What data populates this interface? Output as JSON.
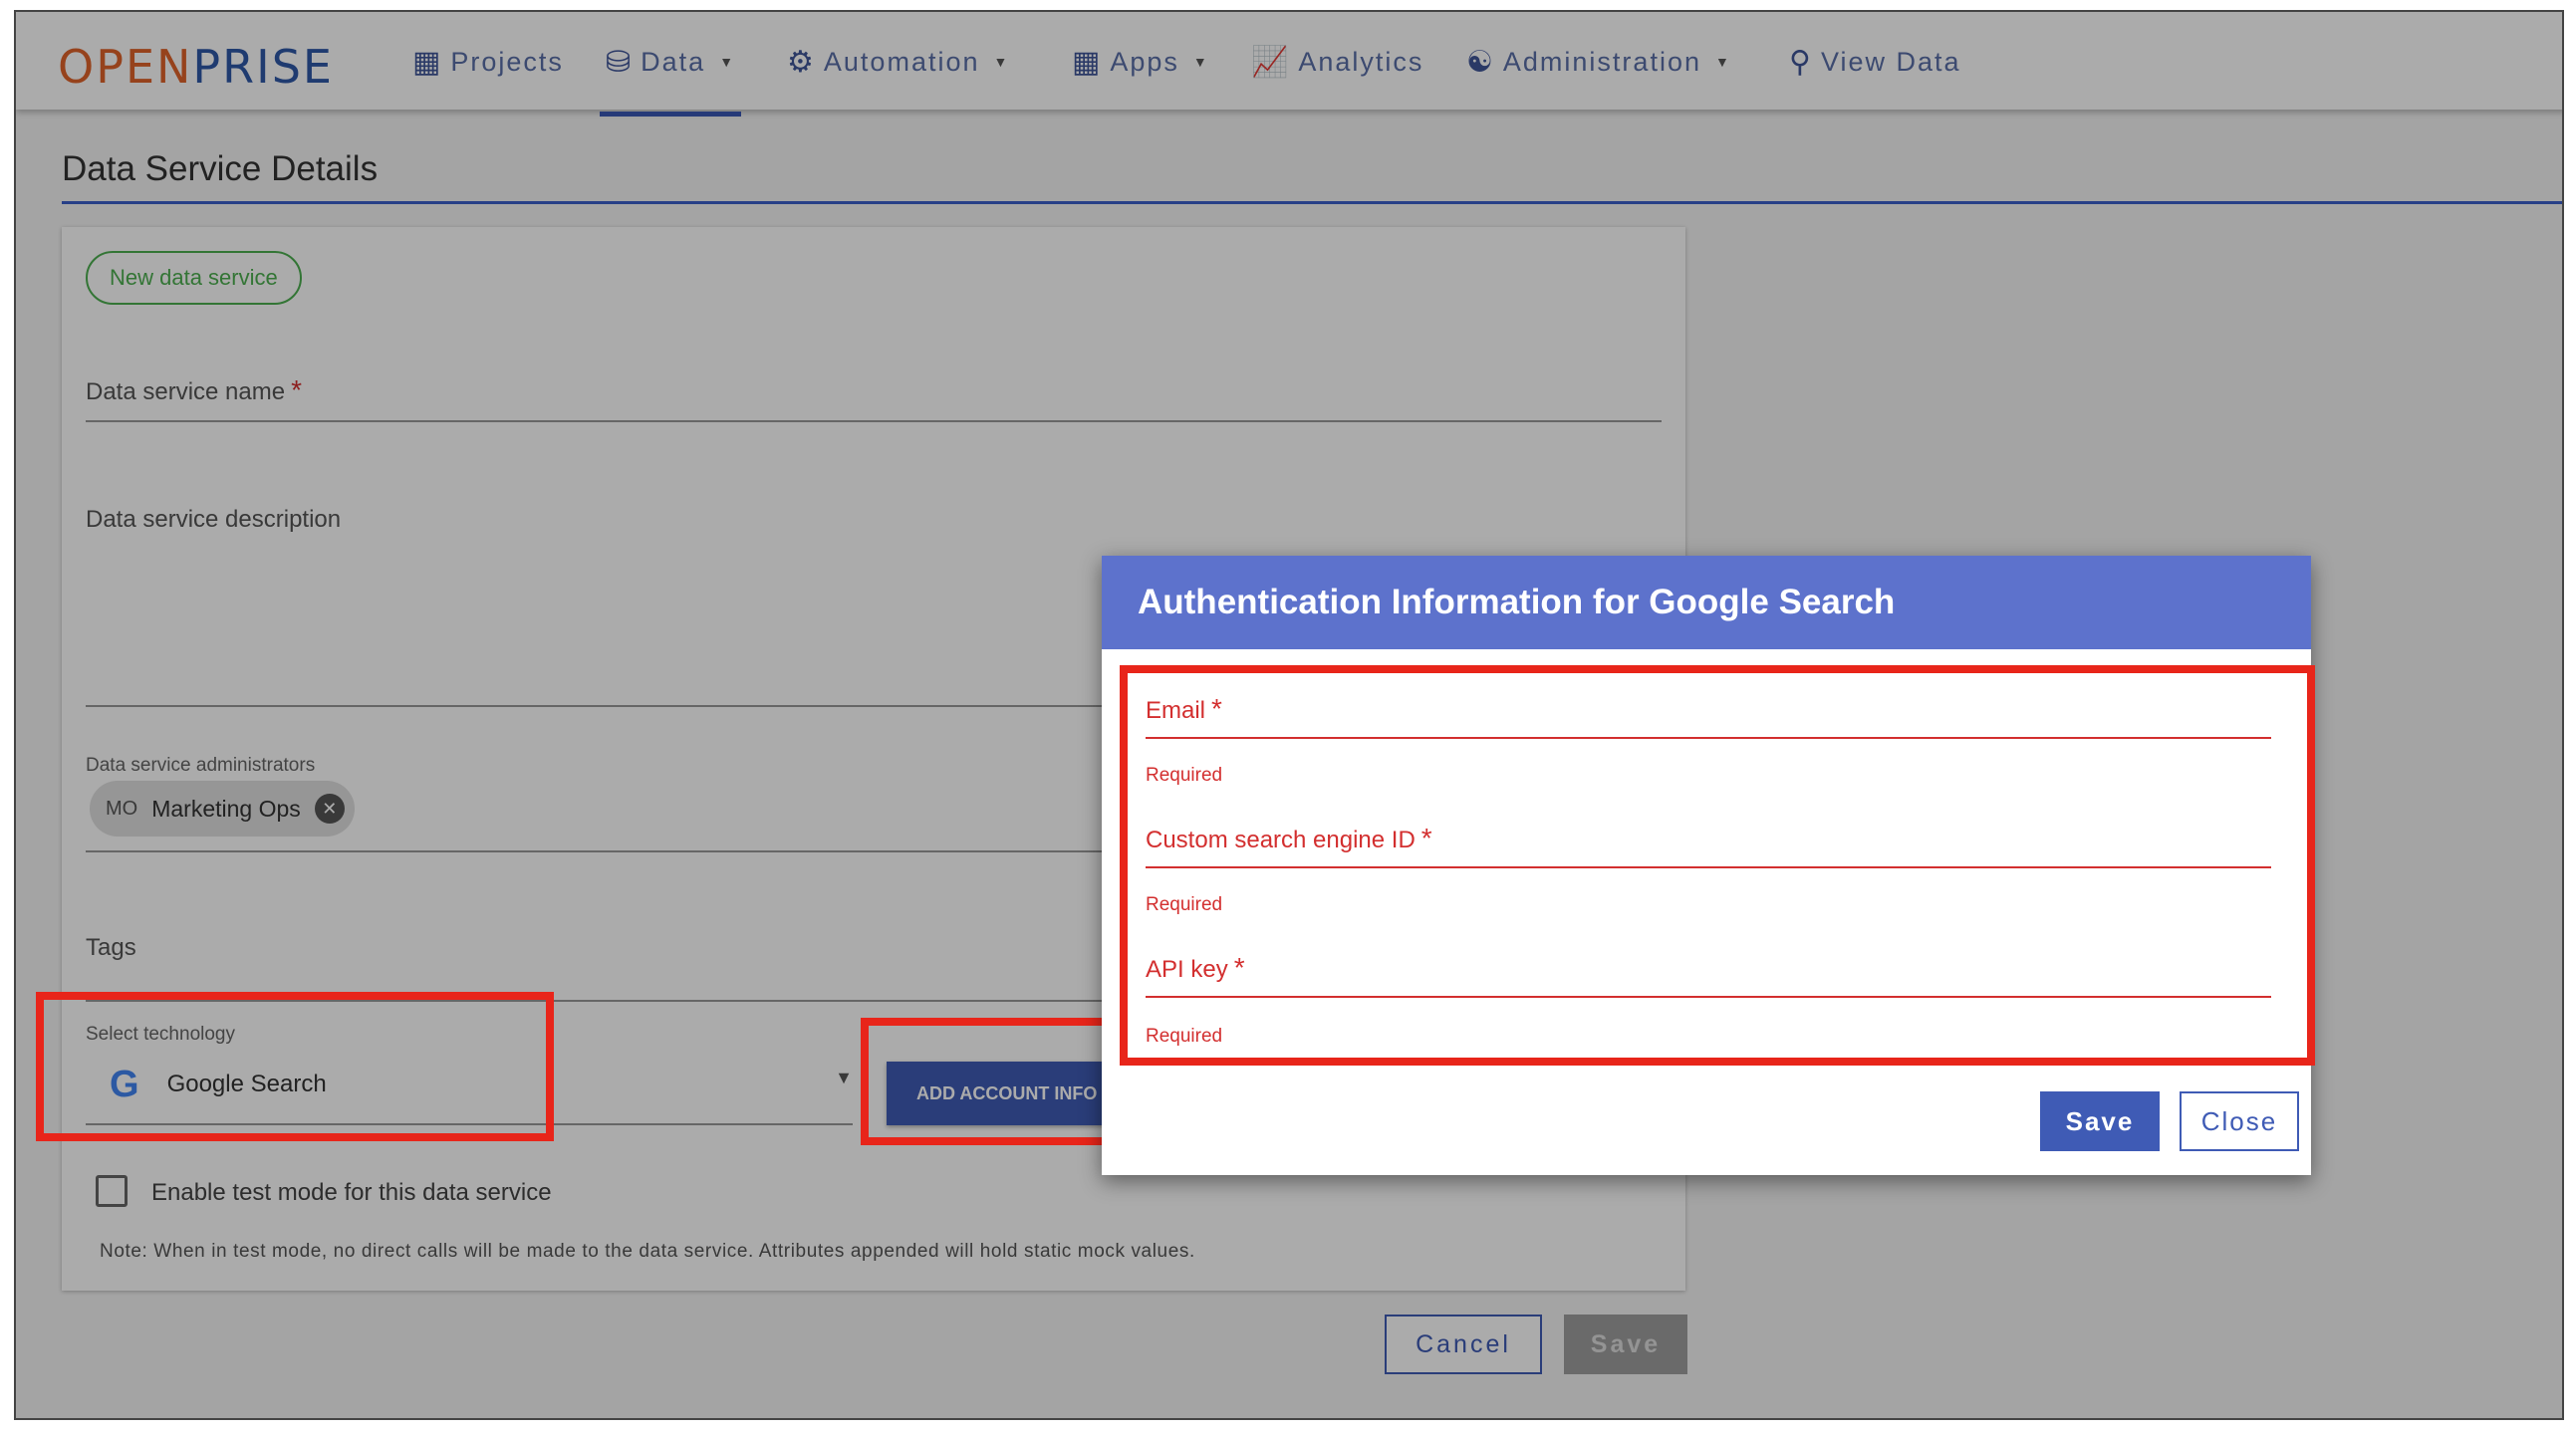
{
  "nav": {
    "logo_part1": "OPEN",
    "logo_part2": "PRISE",
    "items": [
      {
        "label": "Projects",
        "icon": "grid-icon"
      },
      {
        "label": "Data",
        "icon": "database-icon"
      },
      {
        "label": "Automation",
        "icon": "gears-icon"
      },
      {
        "label": "Apps",
        "icon": "grid-icon"
      },
      {
        "label": "Analytics",
        "icon": "chart-icon"
      },
      {
        "label": "Administration",
        "icon": "user-gear-icon"
      },
      {
        "label": "View Data",
        "icon": "search-icon"
      }
    ]
  },
  "page": {
    "title": "Data Service Details"
  },
  "form": {
    "new_chip": "New data service",
    "name_label": "Data service name",
    "description_label": "Data service description",
    "admins_label": "Data service administrators",
    "admin_chip": {
      "initials": "MO",
      "name": "Marketing Ops"
    },
    "tags_label": "Tags",
    "technology_label": "Select technology",
    "technology_value": "Google Search",
    "add_account_label": "ADD ACCOUNT INFO",
    "test_mode_label": "Enable test mode for this data service",
    "note": "Note: When in test mode, no direct calls will be made to the data service. Attributes appended will hold static mock values.",
    "cancel_label": "Cancel",
    "save_label": "Save"
  },
  "modal": {
    "title": "Authentication Information for Google Search",
    "fields": [
      {
        "label": "Email",
        "help": "Required"
      },
      {
        "label": "Custom search engine ID",
        "help": "Required"
      },
      {
        "label": "API key",
        "help": "Required"
      }
    ],
    "save_label": "Save",
    "close_label": "Close"
  },
  "colors": {
    "accent": "#3f5bb5",
    "modal_header": "#5d72cc",
    "error": "#d32f2f",
    "callout": "#e8251a",
    "logo_orange": "#e0632a",
    "logo_blue": "#2f58a8"
  }
}
